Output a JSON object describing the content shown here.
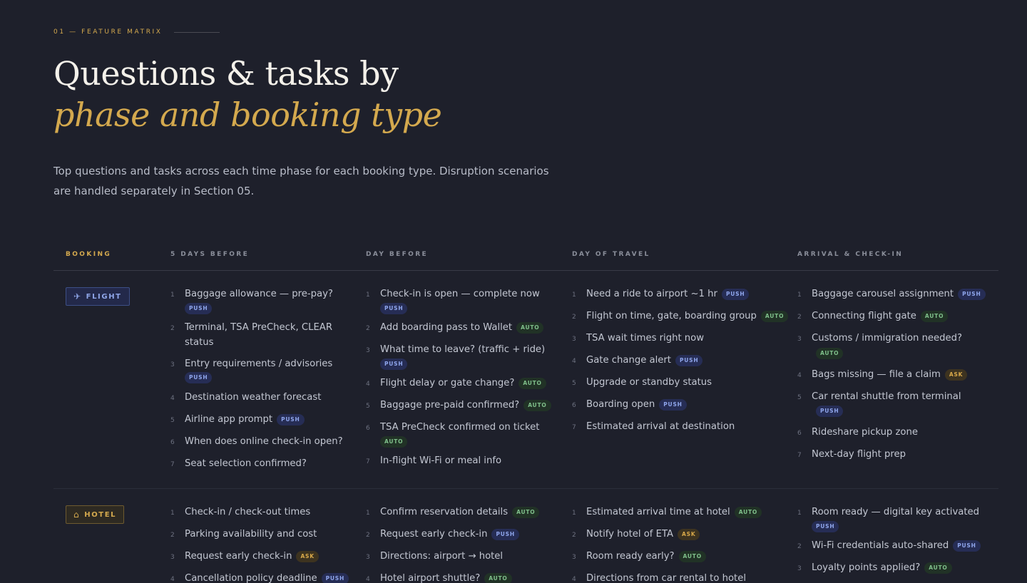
{
  "section": {
    "eyebrow": "01 — FEATURE MATRIX"
  },
  "title": {
    "line1": "Questions & tasks by",
    "line2": "phase and booking type"
  },
  "intro": "Top questions and tasks across each time phase for each booking type. Disruption scenarios are handled separately in Section 05.",
  "columns": [
    "BOOKING",
    "5 DAYS BEFORE",
    "DAY BEFORE",
    "DAY OF TRAVEL",
    "ARRIVAL & CHECK-IN"
  ],
  "colors": {
    "accent": "#d4a94e",
    "push": "#8fa6ec",
    "auto": "#7fbf8a",
    "ask": "#d9a94a",
    "background": "#1e202b"
  },
  "rows": [
    {
      "booking": "FLIGHT",
      "icon": "plane-icon",
      "cls": "fl",
      "rowcls": "flight",
      "phases": [
        [
          {
            "text": "Baggage allowance — pre-pay?",
            "tag": "PUSH",
            "br": true
          },
          {
            "text": "Terminal, TSA PreCheck, CLEAR status"
          },
          {
            "text": "Entry requirements / advisories",
            "tag": "PUSH",
            "br": true
          },
          {
            "text": "Destination weather forecast"
          },
          {
            "text": "Airline app prompt",
            "tag": "PUSH"
          },
          {
            "text": "When does online check-in open?"
          },
          {
            "text": "Seat selection confirmed?"
          }
        ],
        [
          {
            "text": "Check-in is open — complete now",
            "tag": "PUSH",
            "br": true
          },
          {
            "text": "Add boarding pass to Wallet",
            "tag": "AUTO"
          },
          {
            "text": "What time to leave? (traffic + ride)",
            "tag": "PUSH",
            "br": true
          },
          {
            "text": "Flight delay or gate change?",
            "tag": "AUTO"
          },
          {
            "text": "Baggage pre-paid confirmed?",
            "tag": "AUTO"
          },
          {
            "text": "TSA PreCheck confirmed on ticket",
            "tag": "AUTO",
            "br": true
          },
          {
            "text": "In-flight Wi-Fi or meal info"
          }
        ],
        [
          {
            "text": "Need a ride to airport ~1 hr",
            "tag": "PUSH"
          },
          {
            "text": "Flight on time, gate, boarding group",
            "tag": "AUTO"
          },
          {
            "text": "TSA wait times right now"
          },
          {
            "text": "Gate change alert",
            "tag": "PUSH"
          },
          {
            "text": "Upgrade or standby status"
          },
          {
            "text": "Boarding open",
            "tag": "PUSH"
          },
          {
            "text": "Estimated arrival at destination"
          }
        ],
        [
          {
            "text": "Baggage carousel assignment",
            "tag": "PUSH"
          },
          {
            "text": "Connecting flight gate",
            "tag": "AUTO"
          },
          {
            "text": "Customs / immigration needed?",
            "tag": "AUTO"
          },
          {
            "text": "Bags missing — file a claim",
            "tag": "ASK"
          },
          {
            "text": "Car rental shuttle from terminal",
            "tag": "PUSH"
          },
          {
            "text": "Rideshare pickup zone"
          },
          {
            "text": "Next-day flight prep"
          }
        ]
      ]
    },
    {
      "booking": "HOTEL",
      "icon": "home-icon",
      "cls": "ht",
      "rowcls": "hotel",
      "phases": [
        [
          {
            "text": "Check-in / check-out times"
          },
          {
            "text": "Parking availability and cost"
          },
          {
            "text": "Request early check-in",
            "tag": "ASK"
          },
          {
            "text": "Cancellation policy deadline",
            "tag": "PUSH"
          }
        ],
        [
          {
            "text": "Confirm reservation details",
            "tag": "AUTO"
          },
          {
            "text": "Request early check-in",
            "tag": "PUSH"
          },
          {
            "text": "Directions: airport → hotel"
          },
          {
            "text": "Hotel airport shuttle?",
            "tag": "AUTO"
          }
        ],
        [
          {
            "text": "Estimated arrival time at hotel",
            "tag": "AUTO"
          },
          {
            "text": "Notify hotel of ETA",
            "tag": "ASK"
          },
          {
            "text": "Room ready early?",
            "tag": "AUTO"
          },
          {
            "text": "Directions from car rental to hotel"
          }
        ],
        [
          {
            "text": "Room ready — digital key activated",
            "tag": "PUSH",
            "br": true
          },
          {
            "text": "Wi-Fi credentials auto-shared",
            "tag": "PUSH"
          },
          {
            "text": "Loyalty points applied?",
            "tag": "AUTO"
          }
        ]
      ]
    }
  ]
}
